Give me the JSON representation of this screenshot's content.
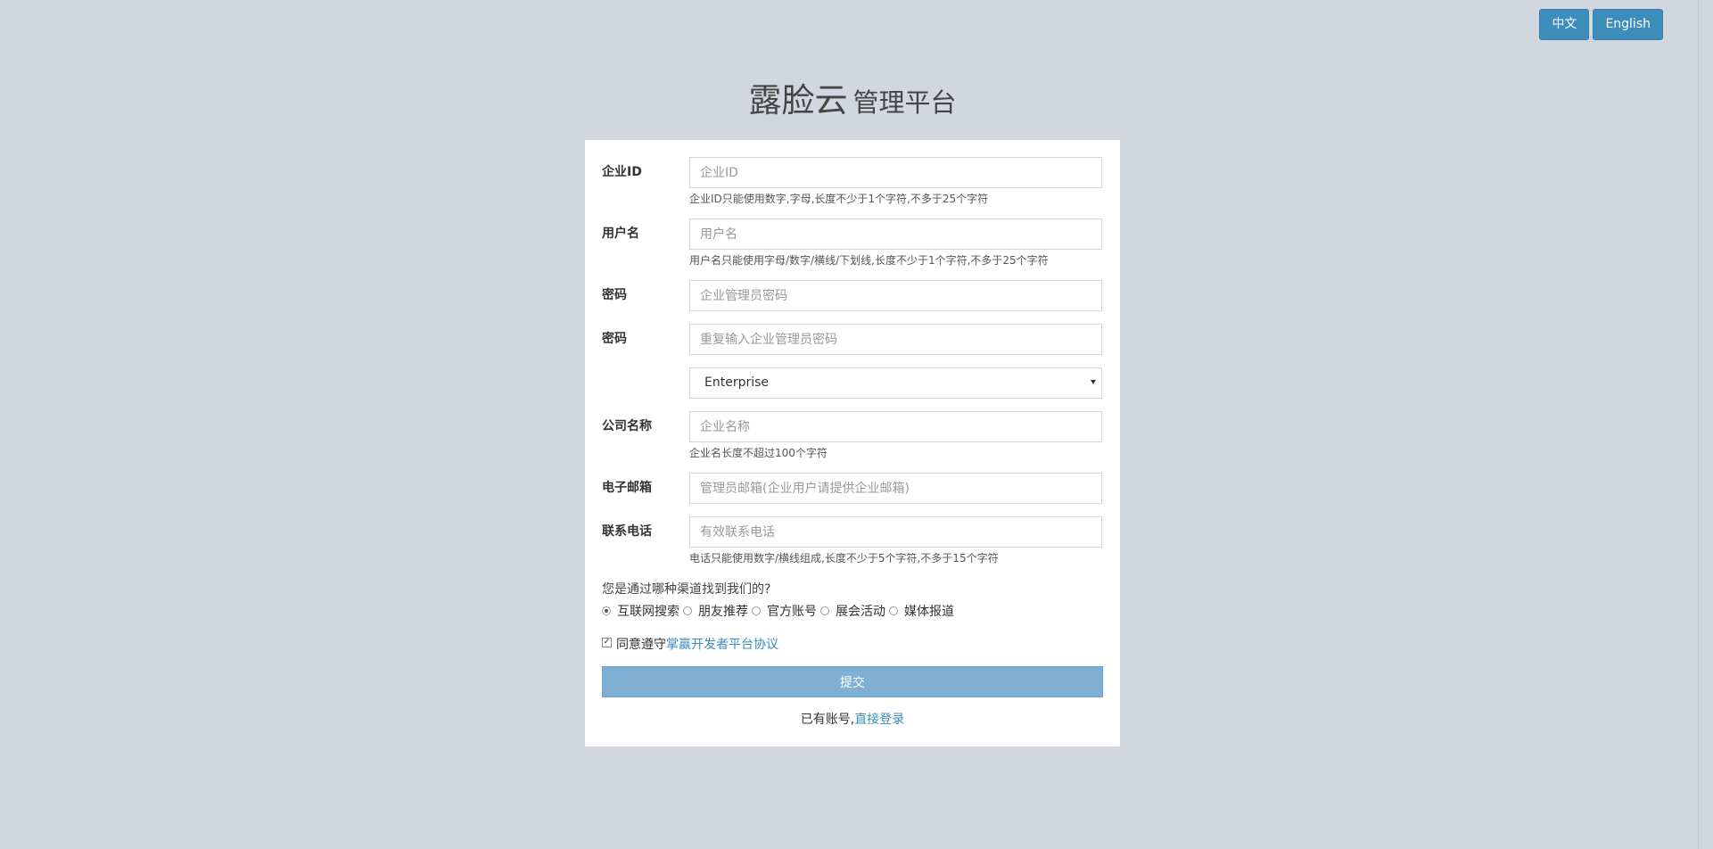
{
  "header": {
    "lang_buttons": [
      "中文",
      "English"
    ]
  },
  "title": {
    "brand": "露脸云",
    "subtitle": "管理平台"
  },
  "form": {
    "company_id": {
      "label": "企业ID",
      "placeholder": "企业ID",
      "help": "企业ID只能使用数字,字母,长度不少于1个字符,不多于25个字符"
    },
    "username": {
      "label": "用户名",
      "placeholder": "用户名",
      "help": "用户名只能使用字母/数字/横线/下划线,长度不少于1个字符,不多于25个字符"
    },
    "password": {
      "label": "密码",
      "placeholder": "企业管理员密码"
    },
    "password_confirm": {
      "label": "密码",
      "placeholder": "重复输入企业管理员密码"
    },
    "account_type": {
      "selected": "Enterprise"
    },
    "company_name": {
      "label": "公司名称",
      "placeholder": "企业名称",
      "help": "企业名长度不超过100个字符"
    },
    "email": {
      "label": "电子邮箱",
      "placeholder": "管理员邮箱(企业用户请提供企业邮箱)"
    },
    "phone": {
      "label": "联系电话",
      "placeholder": "有效联系电话",
      "help": "电话只能使用数字/横线组成,长度不少于5个字符,不多于15个字符"
    },
    "source_question": "您是通过哪种渠道找到我们的?",
    "source_options": [
      "互联网搜索",
      "朋友推荐",
      "官方账号",
      "展会活动",
      "媒体报道"
    ],
    "source_selected_index": 0,
    "agree_prefix": "同意遵守",
    "agree_link": "掌赢开发者平台协议",
    "agree_checked": true,
    "submit_label": "提交",
    "login_prefix": "已有账号,",
    "login_link": "直接登录"
  }
}
